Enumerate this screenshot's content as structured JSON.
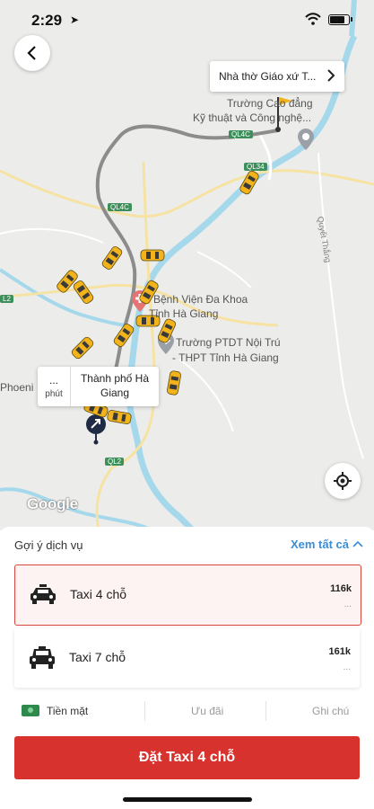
{
  "status_bar": {
    "time": "2:29",
    "location_glyph": "➤"
  },
  "map": {
    "destination_tooltip": "Nhà thờ Giáo xứ T...",
    "origin_tooltip": {
      "eta_value": "...",
      "eta_unit": "phút",
      "name": "Thành phố Hà Giang"
    },
    "labels": {
      "school": "Trường Cao đẳng",
      "school2": "Kỹ thuật và Công nghệ...",
      "hospital": "Bệnh Viện Đa Khoa",
      "hospital2": "Tỉnh Hà Giang",
      "ptdt": "Trường PTDT Nội Trú",
      "ptdt2": "- THPT Tỉnh Hà Giang",
      "phoenix": "Phoeni",
      "road_ql4c": "QL4C",
      "road_ql34": "QL34",
      "road_ql40": "QL4C",
      "road_ql2": "QL2",
      "road_l2": "L2",
      "quyet_thang": "Quyết Thắng"
    },
    "google": "Google"
  },
  "services": {
    "title": "Gợi ý dịch vụ",
    "see_all": "Xem tất cả",
    "items": [
      {
        "label": "Taxi 4 chỗ",
        "price": "116k",
        "sub": "...",
        "selected": true
      },
      {
        "label": "Taxi 7 chỗ",
        "price": "161k",
        "sub": "...",
        "selected": false
      }
    ]
  },
  "options": {
    "payment": "Tiền mặt",
    "promo": "Ưu đãi",
    "note": "Ghi chú"
  },
  "book_button": "Đặt Taxi 4 chỗ",
  "colors": {
    "accent": "#d7322e",
    "link": "#3a8dd8",
    "river": "#a6d8ec",
    "route": "#8c8c8c",
    "taxi": "#f2b31b"
  }
}
